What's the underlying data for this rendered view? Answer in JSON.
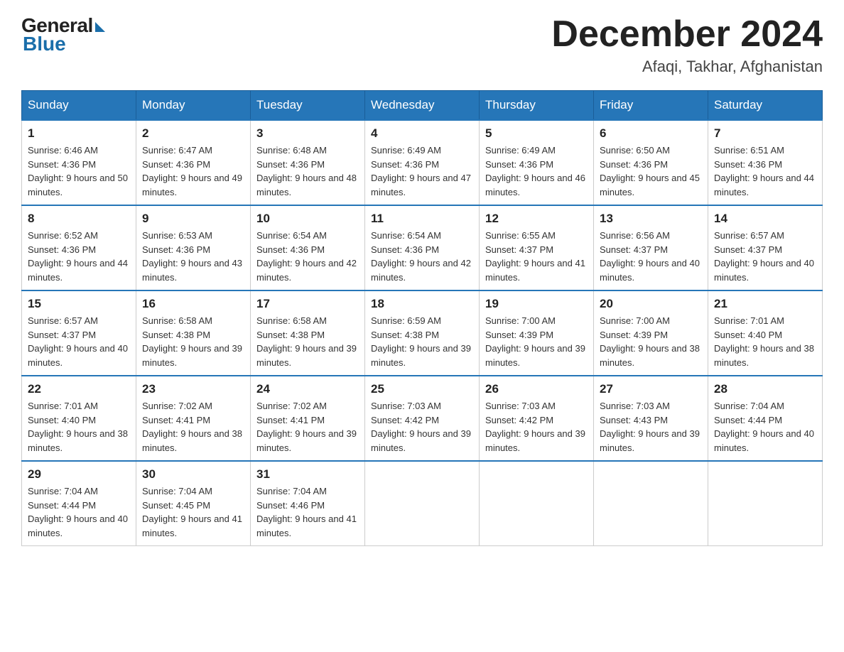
{
  "logo": {
    "general": "General",
    "blue": "Blue"
  },
  "title": "December 2024",
  "location": "Afaqi, Takhar, Afghanistan",
  "days_of_week": [
    "Sunday",
    "Monday",
    "Tuesday",
    "Wednesday",
    "Thursday",
    "Friday",
    "Saturday"
  ],
  "weeks": [
    [
      {
        "day": "1",
        "sunrise": "6:46 AM",
        "sunset": "4:36 PM",
        "daylight": "9 hours and 50 minutes."
      },
      {
        "day": "2",
        "sunrise": "6:47 AM",
        "sunset": "4:36 PM",
        "daylight": "9 hours and 49 minutes."
      },
      {
        "day": "3",
        "sunrise": "6:48 AM",
        "sunset": "4:36 PM",
        "daylight": "9 hours and 48 minutes."
      },
      {
        "day": "4",
        "sunrise": "6:49 AM",
        "sunset": "4:36 PM",
        "daylight": "9 hours and 47 minutes."
      },
      {
        "day": "5",
        "sunrise": "6:49 AM",
        "sunset": "4:36 PM",
        "daylight": "9 hours and 46 minutes."
      },
      {
        "day": "6",
        "sunrise": "6:50 AM",
        "sunset": "4:36 PM",
        "daylight": "9 hours and 45 minutes."
      },
      {
        "day": "7",
        "sunrise": "6:51 AM",
        "sunset": "4:36 PM",
        "daylight": "9 hours and 44 minutes."
      }
    ],
    [
      {
        "day": "8",
        "sunrise": "6:52 AM",
        "sunset": "4:36 PM",
        "daylight": "9 hours and 44 minutes."
      },
      {
        "day": "9",
        "sunrise": "6:53 AM",
        "sunset": "4:36 PM",
        "daylight": "9 hours and 43 minutes."
      },
      {
        "day": "10",
        "sunrise": "6:54 AM",
        "sunset": "4:36 PM",
        "daylight": "9 hours and 42 minutes."
      },
      {
        "day": "11",
        "sunrise": "6:54 AM",
        "sunset": "4:36 PM",
        "daylight": "9 hours and 42 minutes."
      },
      {
        "day": "12",
        "sunrise": "6:55 AM",
        "sunset": "4:37 PM",
        "daylight": "9 hours and 41 minutes."
      },
      {
        "day": "13",
        "sunrise": "6:56 AM",
        "sunset": "4:37 PM",
        "daylight": "9 hours and 40 minutes."
      },
      {
        "day": "14",
        "sunrise": "6:57 AM",
        "sunset": "4:37 PM",
        "daylight": "9 hours and 40 minutes."
      }
    ],
    [
      {
        "day": "15",
        "sunrise": "6:57 AM",
        "sunset": "4:37 PM",
        "daylight": "9 hours and 40 minutes."
      },
      {
        "day": "16",
        "sunrise": "6:58 AM",
        "sunset": "4:38 PM",
        "daylight": "9 hours and 39 minutes."
      },
      {
        "day": "17",
        "sunrise": "6:58 AM",
        "sunset": "4:38 PM",
        "daylight": "9 hours and 39 minutes."
      },
      {
        "day": "18",
        "sunrise": "6:59 AM",
        "sunset": "4:38 PM",
        "daylight": "9 hours and 39 minutes."
      },
      {
        "day": "19",
        "sunrise": "7:00 AM",
        "sunset": "4:39 PM",
        "daylight": "9 hours and 39 minutes."
      },
      {
        "day": "20",
        "sunrise": "7:00 AM",
        "sunset": "4:39 PM",
        "daylight": "9 hours and 38 minutes."
      },
      {
        "day": "21",
        "sunrise": "7:01 AM",
        "sunset": "4:40 PM",
        "daylight": "9 hours and 38 minutes."
      }
    ],
    [
      {
        "day": "22",
        "sunrise": "7:01 AM",
        "sunset": "4:40 PM",
        "daylight": "9 hours and 38 minutes."
      },
      {
        "day": "23",
        "sunrise": "7:02 AM",
        "sunset": "4:41 PM",
        "daylight": "9 hours and 38 minutes."
      },
      {
        "day": "24",
        "sunrise": "7:02 AM",
        "sunset": "4:41 PM",
        "daylight": "9 hours and 39 minutes."
      },
      {
        "day": "25",
        "sunrise": "7:03 AM",
        "sunset": "4:42 PM",
        "daylight": "9 hours and 39 minutes."
      },
      {
        "day": "26",
        "sunrise": "7:03 AM",
        "sunset": "4:42 PM",
        "daylight": "9 hours and 39 minutes."
      },
      {
        "day": "27",
        "sunrise": "7:03 AM",
        "sunset": "4:43 PM",
        "daylight": "9 hours and 39 minutes."
      },
      {
        "day": "28",
        "sunrise": "7:04 AM",
        "sunset": "4:44 PM",
        "daylight": "9 hours and 40 minutes."
      }
    ],
    [
      {
        "day": "29",
        "sunrise": "7:04 AM",
        "sunset": "4:44 PM",
        "daylight": "9 hours and 40 minutes."
      },
      {
        "day": "30",
        "sunrise": "7:04 AM",
        "sunset": "4:45 PM",
        "daylight": "9 hours and 41 minutes."
      },
      {
        "day": "31",
        "sunrise": "7:04 AM",
        "sunset": "4:46 PM",
        "daylight": "9 hours and 41 minutes."
      },
      null,
      null,
      null,
      null
    ]
  ]
}
